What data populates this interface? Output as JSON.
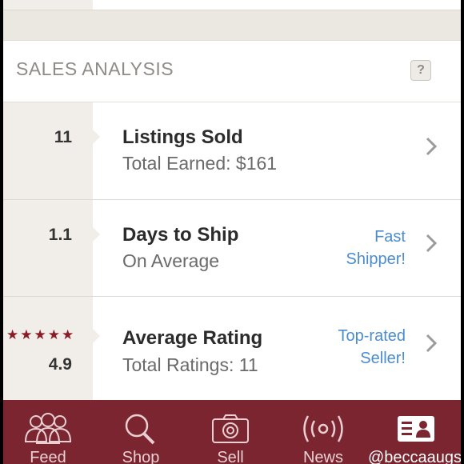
{
  "section": {
    "title": "SALES ANALYSIS",
    "help": "?"
  },
  "rows": [
    {
      "stat": "11",
      "title": "Listings Sold",
      "subtitle": "Total Earned: $161",
      "badge": ""
    },
    {
      "stat": "1.1",
      "title": "Days to Ship",
      "subtitle": "On Average",
      "badge_lines": [
        "Fast",
        "Shipper!"
      ]
    },
    {
      "stat": "4.9",
      "stars": "★★★★★",
      "rating": 4.9,
      "title": "Average Rating",
      "subtitle": "Total Ratings: 11",
      "badge_lines": [
        "Top-rated",
        "Seller!"
      ]
    }
  ],
  "tabs": [
    {
      "label": "Feed",
      "icon": "people-icon"
    },
    {
      "label": "Shop",
      "icon": "search-icon"
    },
    {
      "label": "Sell",
      "icon": "camera-icon"
    },
    {
      "label": "News",
      "icon": "broadcast-icon"
    },
    {
      "label": "@beccaaugs",
      "icon": "profile-card-icon",
      "active": true
    }
  ],
  "colors": {
    "tabbar": "#7a2530",
    "accent_link": "#4a8ccf",
    "star": "#8a1c26"
  }
}
